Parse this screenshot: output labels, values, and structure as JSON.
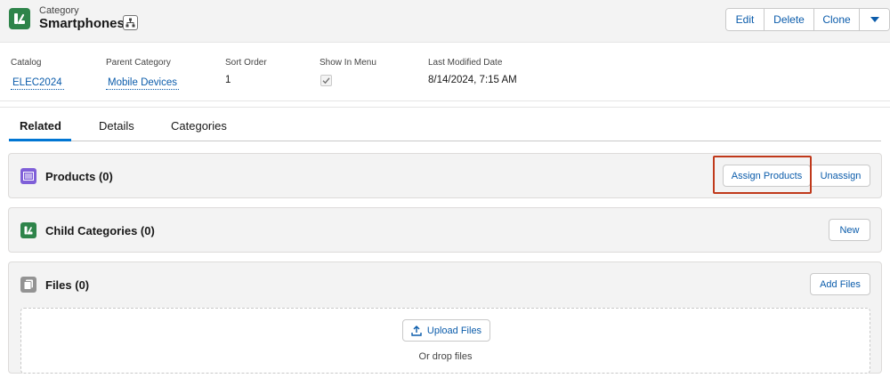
{
  "header": {
    "object_type": "Category",
    "title": "Smartphones",
    "actions": {
      "edit": "Edit",
      "delete": "Delete",
      "clone": "Clone"
    }
  },
  "highlights": [
    {
      "label": "Catalog",
      "value": "ELEC2024",
      "link": true
    },
    {
      "label": "Parent Category",
      "value": "Mobile Devices",
      "link": true
    },
    {
      "label": "Sort Order",
      "value": "1",
      "link": false
    },
    {
      "label": "Show In Menu",
      "checked": true
    },
    {
      "label": "Last Modified Date",
      "value": "8/14/2024, 7:15 AM",
      "link": false
    }
  ],
  "tabs": [
    {
      "label": "Related",
      "active": true
    },
    {
      "label": "Details",
      "active": false
    },
    {
      "label": "Categories",
      "active": false
    }
  ],
  "related": {
    "products": {
      "title": "Products (0)",
      "assign_label": "Assign Products",
      "unassign_label": "Unassign"
    },
    "child_categories": {
      "title": "Child Categories (0)",
      "new_label": "New"
    },
    "files": {
      "title": "Files (0)",
      "add_label": "Add Files",
      "upload_label": "Upload Files",
      "drop_text": "Or drop files"
    }
  },
  "colors": {
    "brand": "#0b5cab",
    "category_icon": "#2e844a",
    "products_icon": "#7f5fd8",
    "files_icon": "#939393",
    "highlight": "#c0391b"
  },
  "icons": {
    "object": "category-icon",
    "hierarchy": "hierarchy-icon",
    "products": "products-icon",
    "child_categories": "category-icon",
    "files": "files-icon",
    "upload": "upload-icon"
  }
}
